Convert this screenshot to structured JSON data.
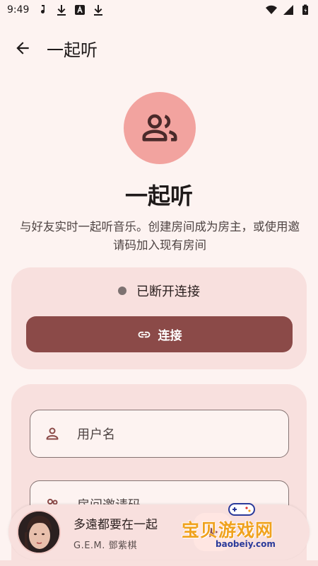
{
  "status_bar": {
    "time": "9:49"
  },
  "app_bar": {
    "title": "一起听"
  },
  "hero": {
    "title": "一起听",
    "description": "与好友实时一起听音乐。创建房间成为房主，或使用邀请码加入现有房间"
  },
  "connection": {
    "status": "已断开连接",
    "connect_label": "连接"
  },
  "form": {
    "username_placeholder": "用户名",
    "invite_code_placeholder": "房间邀请码"
  },
  "player": {
    "song": "多遠都要在一起",
    "artist": "G.E.M. 鄧紫棋"
  },
  "watermark": {
    "text": "宝贝游戏网",
    "url": "baobeiy.com"
  },
  "colors": {
    "background": "#fdf3f1",
    "card": "#f8e0de",
    "accent": "#8b4a48",
    "avatar_circle": "#f2a39f"
  },
  "icons": [
    "music-note-icon",
    "download-icon",
    "font-icon",
    "download-icon",
    "wifi-icon",
    "signal-icon",
    "battery-icon",
    "back-arrow-icon",
    "group-icon",
    "link-icon",
    "person-icon",
    "room-icon",
    "play-icon",
    "gamepad-icon"
  ]
}
